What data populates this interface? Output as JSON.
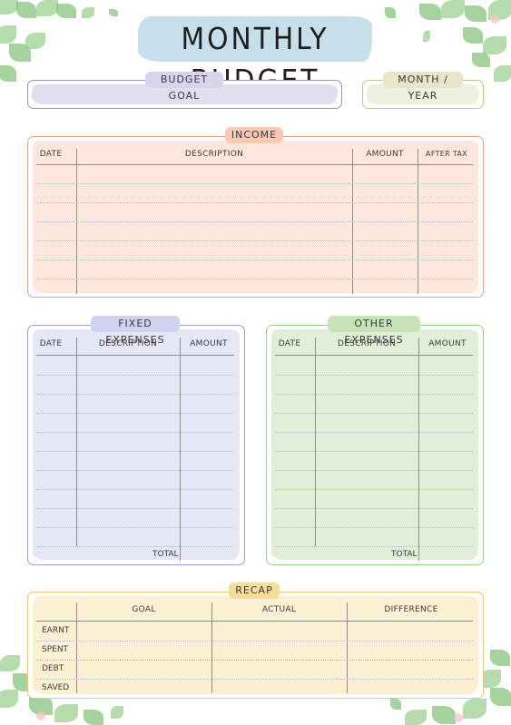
{
  "title": "MONTHLY BUDGET",
  "budget_goal": {
    "label": "BUDGET GOAL",
    "value": ""
  },
  "month_year": {
    "label": "MONTH / YEAR",
    "value": ""
  },
  "income": {
    "label": "INCOME",
    "columns": [
      "DATE",
      "DESCRIPTION",
      "AMOUNT",
      "AFTER TAX"
    ],
    "row_count": 7
  },
  "fixed_expenses": {
    "label": "FIXED EXPENSES",
    "columns": [
      "DATE",
      "DESCRIPTION",
      "AMOUNT"
    ],
    "row_count": 10,
    "total_label": "TOTAL"
  },
  "other_expenses": {
    "label": "OTHER EXPENSES",
    "columns": [
      "DATE",
      "DESCRIPTION",
      "AMOUNT"
    ],
    "row_count": 10,
    "total_label": "TOTAL"
  },
  "recap": {
    "label": "RECAP",
    "columns": [
      "GOAL",
      "ACTUAL",
      "DIFFERENCE"
    ],
    "rows": [
      "EARNT",
      "SPENT",
      "DEBT",
      "SAVED"
    ]
  },
  "colors": {
    "title_wash": "#bcd9e8",
    "budget_wash": "#e3ddf0",
    "month_wash": "#eff0e0",
    "income_wash": "#fde6dc",
    "fixed_wash": "#e5e6f6",
    "other_wash": "#e1efd9",
    "recap_wash": "#fdefd2"
  }
}
